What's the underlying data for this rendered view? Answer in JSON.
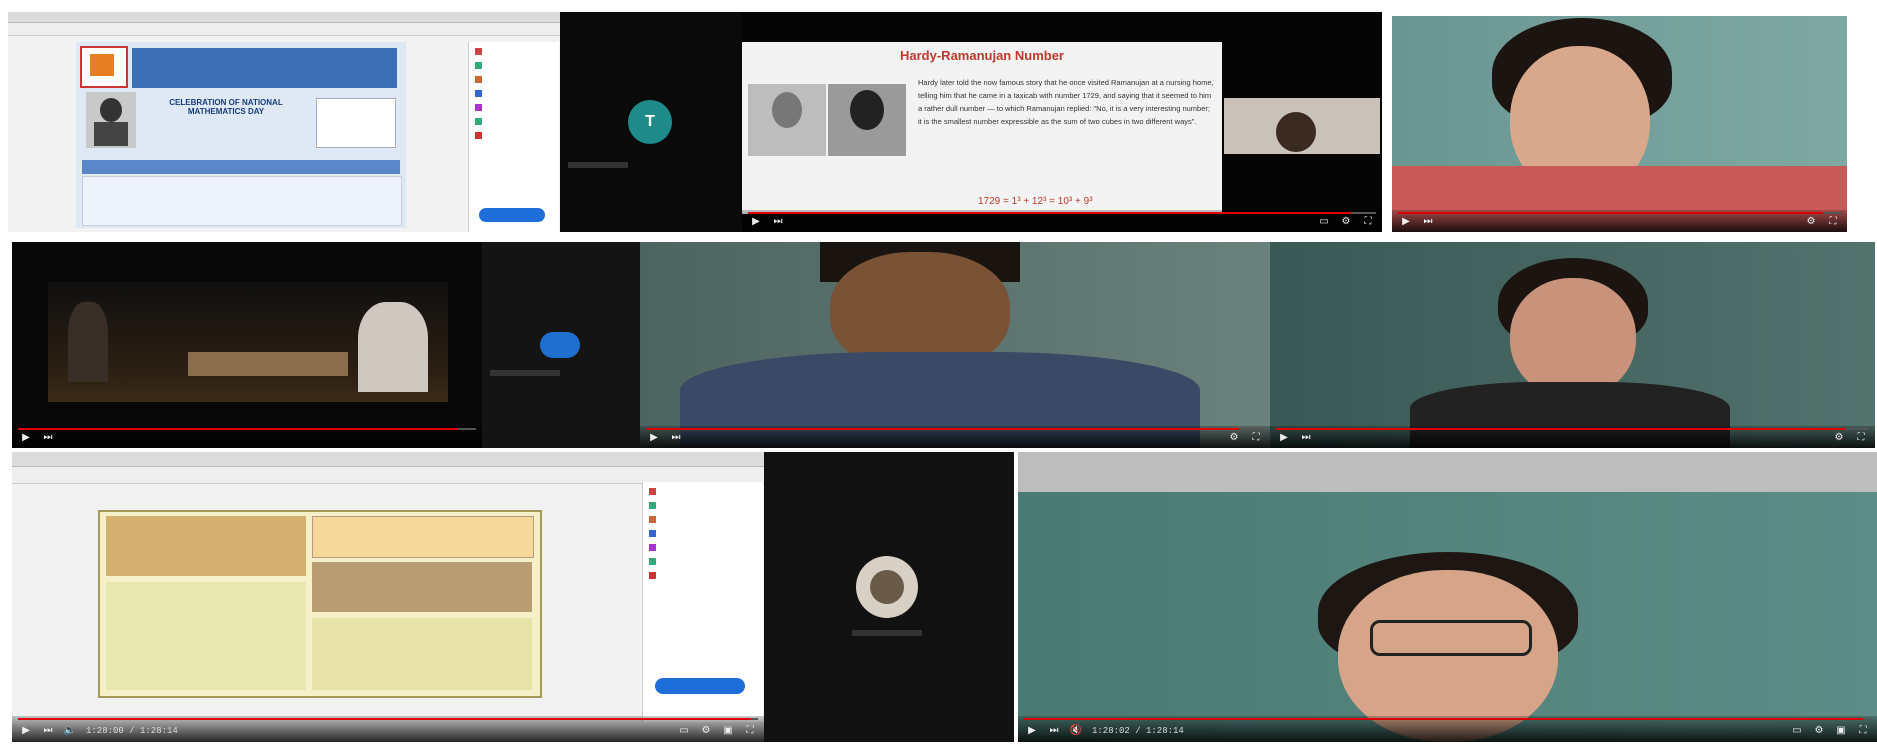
{
  "tiles": {
    "t1": {
      "pdf_heading": "CELEBRATION OF NATIONAL MATHEMATICS DAY"
    },
    "t2": {
      "avatar_letter": "T"
    },
    "t3": {
      "slide_title": "Hardy-Ramanujan Number",
      "slide_text": "Hardy later told the now famous story that he once visited Ramanujan at a nursing home, telling him that he came in a taxicab with number 1729, and saying that it seemed to him a rather dull number — to which Ramanujan replied: \"No, it is a very interesting number; it is the smallest number expressible as the sum of two cubes in two different ways\".",
      "formula": "1729 = 1³ + 12³ = 10³ + 9³"
    },
    "t12": {
      "time": "1:28:00 / 1:28:14"
    },
    "t13": {
      "time": "1:28:02 / 1:28:14"
    }
  },
  "colors": {
    "progress": "#dd0000",
    "chalkboard": "#5f8a86",
    "slide_title": "#c0392b",
    "avatar_teal": "#1e8a8a",
    "avatar_blue": "#1e6fd0"
  },
  "icons": [
    "play-icon",
    "next-icon",
    "volume-icon",
    "subtitles-icon",
    "settings-icon",
    "miniplayer-icon",
    "fullscreen-icon"
  ]
}
